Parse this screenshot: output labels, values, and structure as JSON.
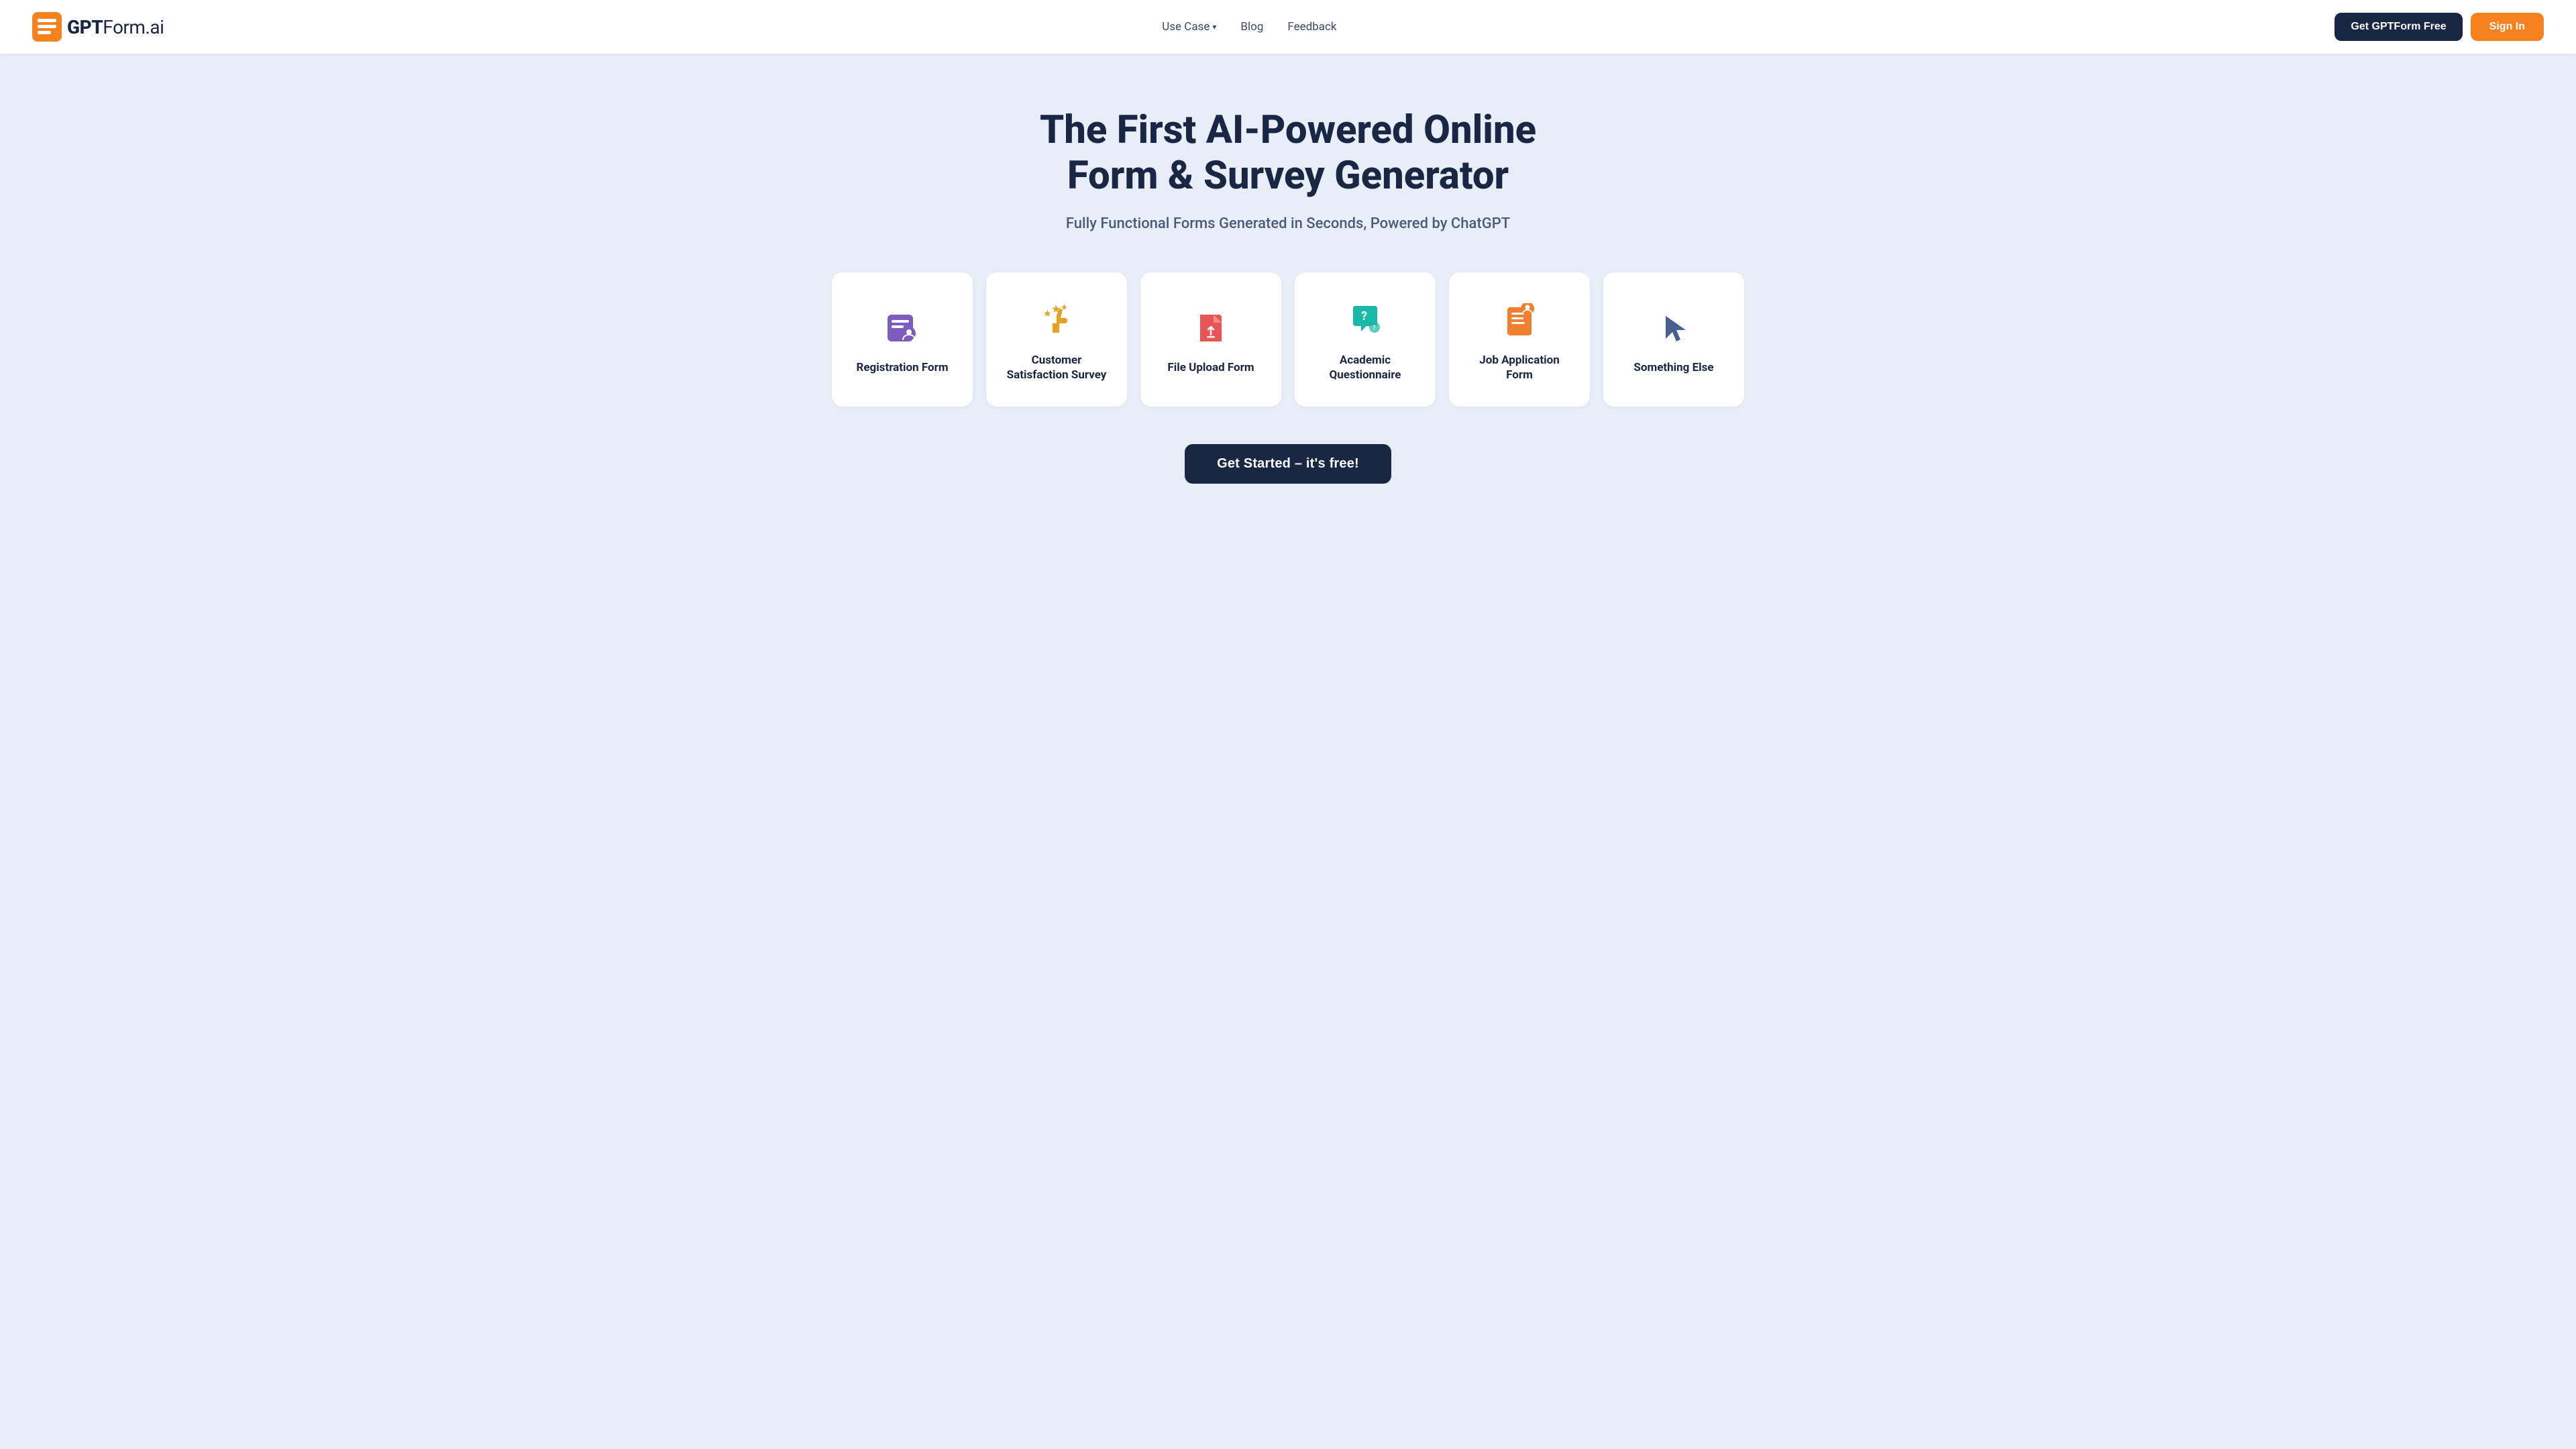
{
  "navbar": {
    "logo_gpt": "GPT",
    "logo_form": "Form",
    "logo_ai": ".ai",
    "nav_use_case": "Use Case",
    "nav_blog": "Blog",
    "nav_feedback": "Feedback",
    "btn_get_free": "Get GPTForm Free",
    "btn_sign_in": "Sign In"
  },
  "hero": {
    "title": "The First AI-Powered Online Form & Survey Generator",
    "subtitle": "Fully Functional Forms Generated in Seconds, Powered by ChatGPT"
  },
  "cards": [
    {
      "id": "registration",
      "label": "Registration Form",
      "icon_name": "registration-icon"
    },
    {
      "id": "satisfaction",
      "label": "Customer Satisfaction Survey",
      "icon_name": "satisfaction-icon"
    },
    {
      "id": "file-upload",
      "label": "File Upload Form",
      "icon_name": "file-upload-icon"
    },
    {
      "id": "academic",
      "label": "Academic Questionnaire",
      "icon_name": "academic-icon"
    },
    {
      "id": "job-application",
      "label": "Job Application Form",
      "icon_name": "job-application-icon"
    },
    {
      "id": "something-else",
      "label": "Something Else",
      "icon_name": "something-else-icon"
    }
  ],
  "cta": {
    "button_label": "Get Started – it's free!"
  }
}
